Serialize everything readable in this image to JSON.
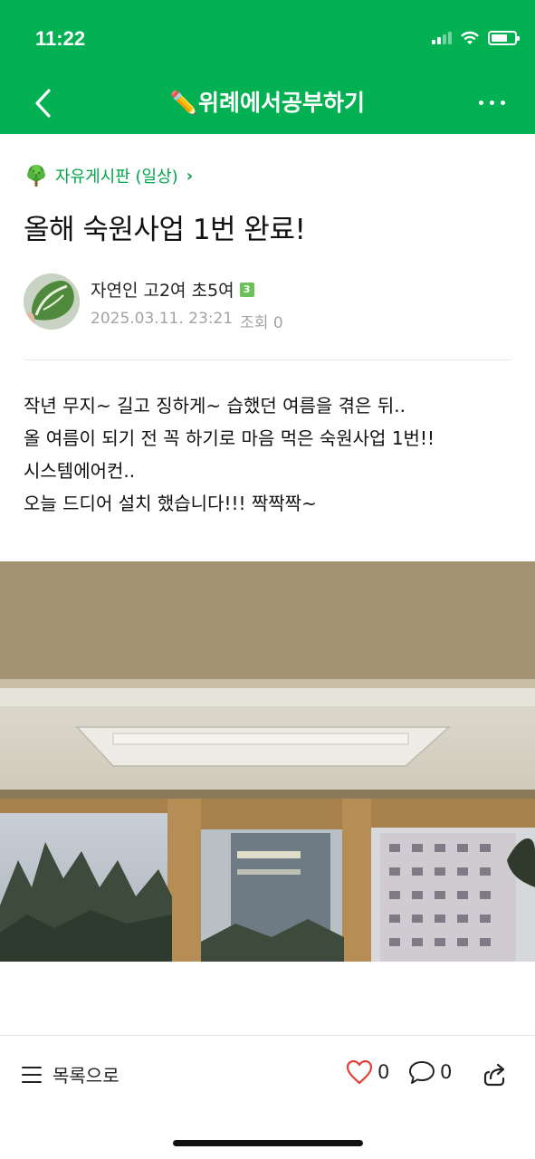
{
  "status_bar": {
    "time": "11:22"
  },
  "nav": {
    "title": "✏️위례에서공부하기"
  },
  "board": {
    "label": "자유게시판 (일상)",
    "chevron": "›"
  },
  "post": {
    "title": "올해 숙원사업 1번 완료!",
    "author": "자연인 고2여 초5여",
    "level": "3",
    "date": "2025.03.11. 23:21",
    "views": "조회 0",
    "lines": [
      "작년 무지~ 길고 징하게~ 습했던 여름을 겪은 뒤..",
      "올 여름이 되기 전 꼭 하기로 마음 먹은 숙원사업 1번!!",
      "시스템에어컨..",
      "오늘 드디어 설치 했습니다!!! 짝짝짝~"
    ],
    "partial_next_line": "· · · · · · · · · · · · · · ·"
  },
  "bottom_bar": {
    "list_label": "목록으로",
    "like_count": "0",
    "comment_count": "0"
  },
  "icons": {
    "back": "back-arrow-icon",
    "more": "more-dots-icon",
    "board": "tree-icon",
    "list": "menu-list-icon",
    "like": "heart-icon",
    "comment": "comment-bubble-icon",
    "share": "share-icon"
  },
  "colors": {
    "brand_green": "#03b052",
    "board_green": "#03a34b",
    "like_red": "#e0413b",
    "meta_gray": "#a3a3a3"
  }
}
